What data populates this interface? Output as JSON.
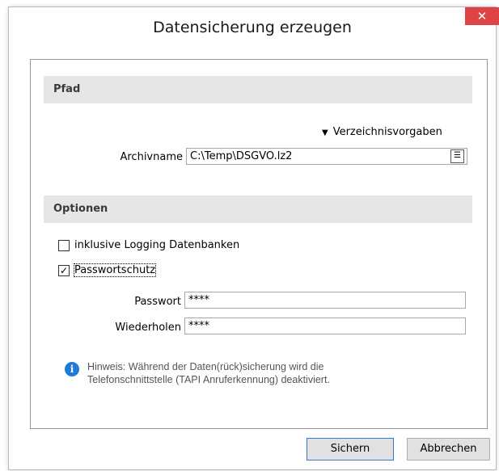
{
  "window": {
    "title": "Datensicherung erzeugen",
    "close_glyph": "✕"
  },
  "pfad": {
    "header": "Pfad",
    "verzeichnis_link": "Verzeichnisvorgaben",
    "archivname_label": "Archivname",
    "archivname_value": "C:\\Temp\\DSGVO.lz2"
  },
  "optionen": {
    "header": "Optionen",
    "logging_label": "inklusive Logging Datenbanken",
    "logging_checked": false,
    "passwort_schutz_label": "Passwortschutz",
    "passwort_schutz_checked": true,
    "check_glyph": "✓",
    "passwort_label": "Passwort",
    "passwort_value": "****",
    "wiederholen_label": "Wiederholen",
    "wiederholen_value": "****"
  },
  "hint": {
    "icon_glyph": "i",
    "line1": "Hinweis: Während der Daten(rück)sicherung wird die",
    "line2": "Telefonschnittstelle (TAPI Anruferkennung) deaktiviert."
  },
  "buttons": {
    "save": "Sichern",
    "cancel": "Abbrechen"
  },
  "colors": {
    "close": "#e04343",
    "info": "#1e7bd6",
    "default_button_border": "#2f7bd0"
  }
}
